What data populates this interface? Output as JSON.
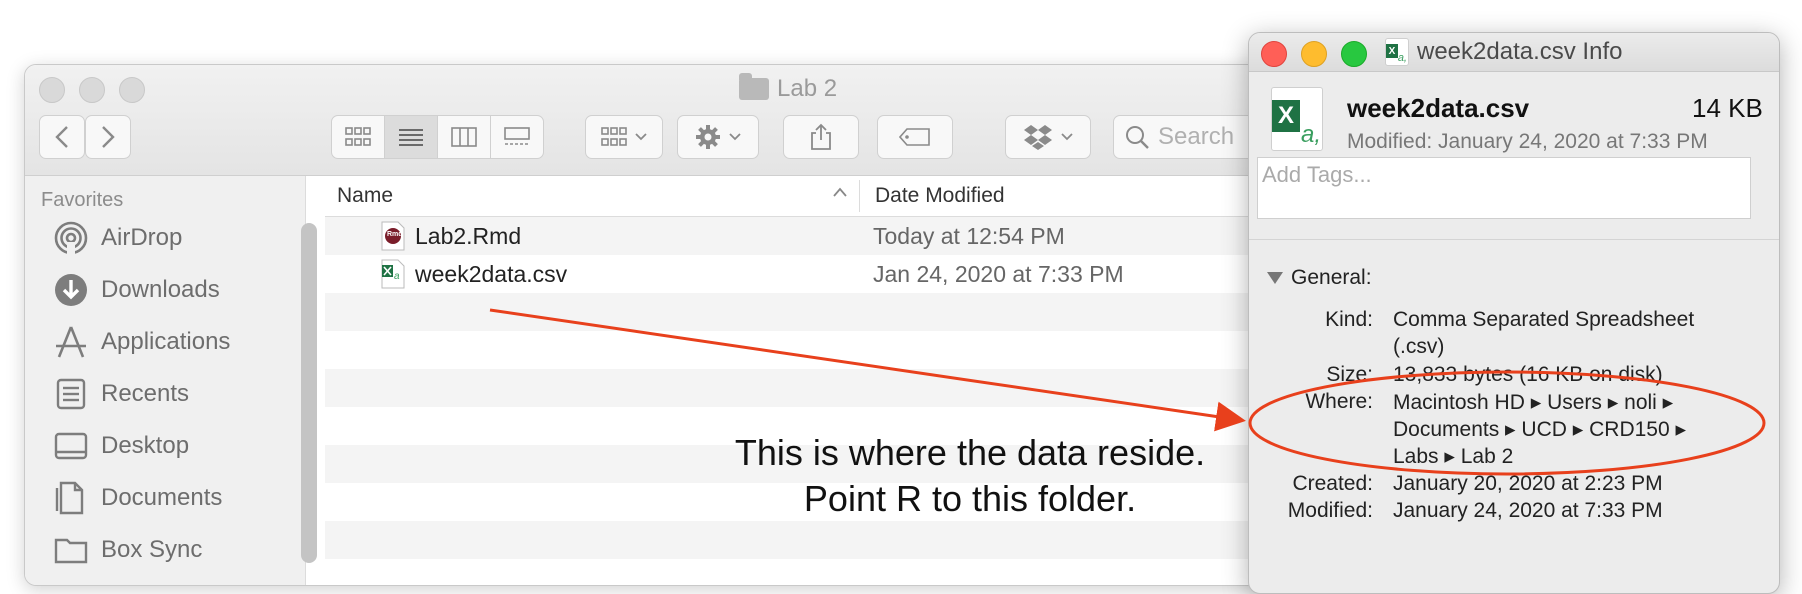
{
  "finder": {
    "title": "Lab 2",
    "search_placeholder": "Search",
    "sidebar": {
      "header": "Favorites",
      "items": [
        {
          "label": "AirDrop",
          "icon": "airdrop-icon"
        },
        {
          "label": "Downloads",
          "icon": "downloads-icon"
        },
        {
          "label": "Applications",
          "icon": "applications-icon"
        },
        {
          "label": "Recents",
          "icon": "recents-icon"
        },
        {
          "label": "Desktop",
          "icon": "desktop-icon"
        },
        {
          "label": "Documents",
          "icon": "documents-icon"
        },
        {
          "label": "Box Sync",
          "icon": "folder-icon"
        }
      ]
    },
    "columns": {
      "name": "Name",
      "date_modified": "Date Modified"
    },
    "files": [
      {
        "name": "Lab2.Rmd",
        "date": "Today at 12:54 PM",
        "icon": "rmd-file-icon",
        "badge": "Rmd"
      },
      {
        "name": "week2data.csv",
        "date": "Jan 24, 2020 at 7:33 PM",
        "icon": "csv-file-icon"
      }
    ]
  },
  "info": {
    "title": "week2data.csv Info",
    "file_name": "week2data.csv",
    "size": "14 KB",
    "modified_line": "Modified: January 24, 2020 at 7:33 PM",
    "tags_placeholder": "Add Tags...",
    "general_label": "General:",
    "icon_letters": {
      "x": "X",
      "a": "a,"
    },
    "fields": {
      "kind_label": "Kind:",
      "kind_value_1": "Comma Separated Spreadsheet",
      "kind_value_2": "(.csv)",
      "size_label": "Size:",
      "size_value": "13,833 bytes (16 KB on disk)",
      "where_label": "Where:",
      "where_1": "Macintosh HD ▸ Users ▸ noli ▸",
      "where_2": "Documents ▸ UCD ▸ CRD150 ▸",
      "where_3": "Labs ▸ Lab 2",
      "created_label": "Created:",
      "created_value": "January 20, 2020 at 2:23 PM",
      "modified_label": "Modified:",
      "modified_value": "January 24, 2020 at 7:33 PM"
    }
  },
  "annotation": {
    "line1": "This is where the data reside.",
    "line2": "Point R to this folder.",
    "color": "#e8401c"
  }
}
